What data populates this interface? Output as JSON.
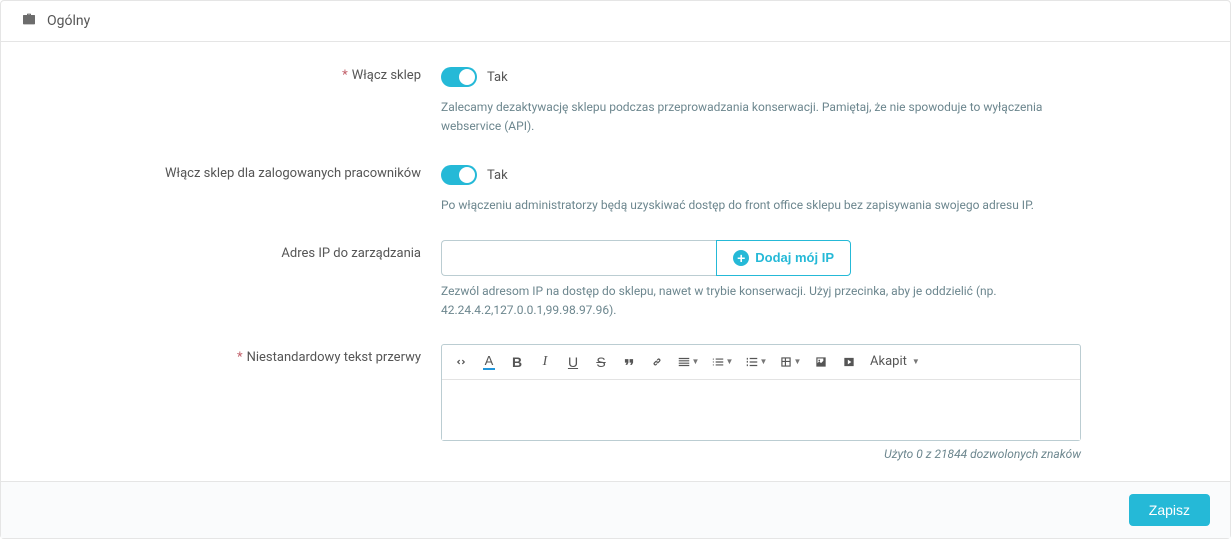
{
  "panel": {
    "title": "Ogólny"
  },
  "fields": {
    "enable_shop": {
      "label": "Włącz sklep",
      "value_label": "Tak",
      "help": "Zalecamy dezaktywację sklepu podczas przeprowadzania konserwacji. Pamiętaj, że nie spowoduje to wyłączenia webservice (API)."
    },
    "enable_employees": {
      "label": "Włącz sklep dla zalogowanych pracowników",
      "value_label": "Tak",
      "help": "Po włączeniu administratorzy będą uzyskiwać dostęp do front office sklepu bez zapisywania swojego adresu IP."
    },
    "ip": {
      "label": "Adres IP do zarządzania",
      "value": "",
      "button": "Dodaj mój IP",
      "help": "Zezwól adresom IP na dostęp do sklepu, nawet w trybie konserwacji. Użyj przecinka, aby je oddzielić (np. 42.24.4.2,127.0.0.1,99.98.97.96)."
    },
    "custom_text": {
      "label": "Niestandardowy tekst przerwy",
      "format_select": "Akapit",
      "counter": "Użyto 0 z 21844 dozwolonych znaków"
    }
  },
  "footer": {
    "save": "Zapisz"
  }
}
